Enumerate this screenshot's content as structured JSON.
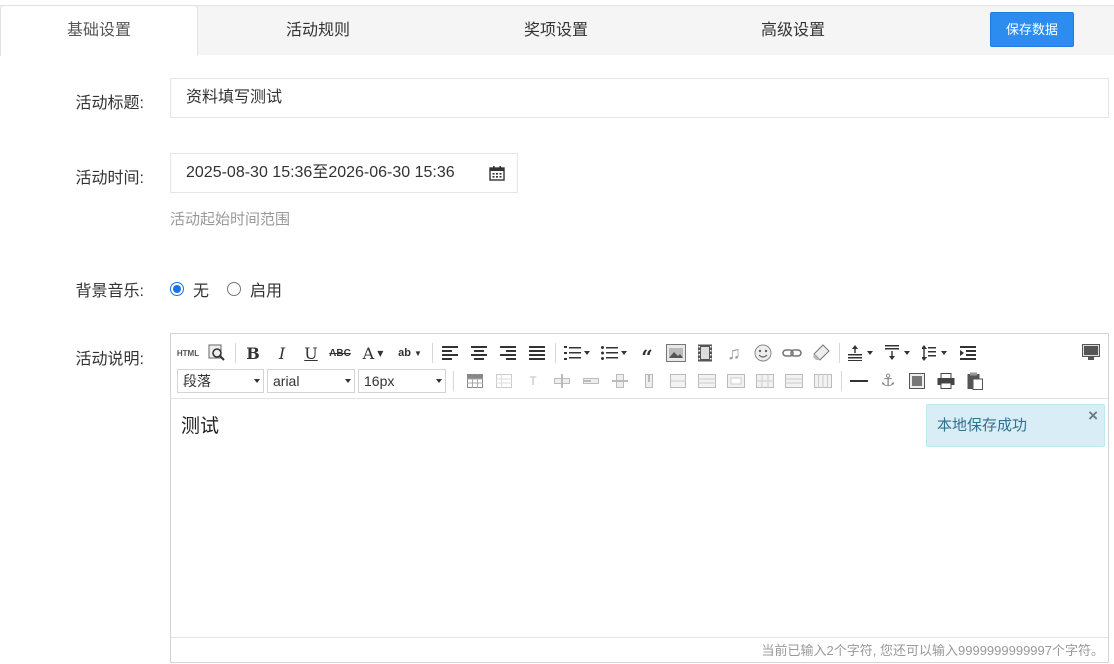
{
  "tabs": [
    {
      "label": "基础设置",
      "active": true
    },
    {
      "label": "活动规则",
      "active": false
    },
    {
      "label": "奖项设置",
      "active": false
    },
    {
      "label": "高级设置",
      "active": false
    }
  ],
  "save_button": "保存数据",
  "form": {
    "title_label": "活动标题:",
    "title_value": "资料填写测试",
    "time_label": "活动时间:",
    "time_value": "2025-08-30 15:36至2026-06-30 15:36",
    "time_help": "活动起始时间范围",
    "music_label": "背景音乐:",
    "music_options": [
      {
        "label": "无",
        "checked": true
      },
      {
        "label": "启用",
        "checked": false
      }
    ],
    "desc_label": "活动说明:"
  },
  "editor": {
    "html_button": "HTML",
    "paragraph_select": "段落",
    "font_select": "arial",
    "size_select": "16px",
    "content": "测试",
    "toast": "本地保存成功",
    "toast_close": "×",
    "counter": "当前已输入2个字符, 您还可以输入9999999999997个字符。"
  },
  "colors": {
    "primary": "#2d8cf0",
    "toast_bg": "#d9edf7",
    "toast_text": "#31708f"
  }
}
